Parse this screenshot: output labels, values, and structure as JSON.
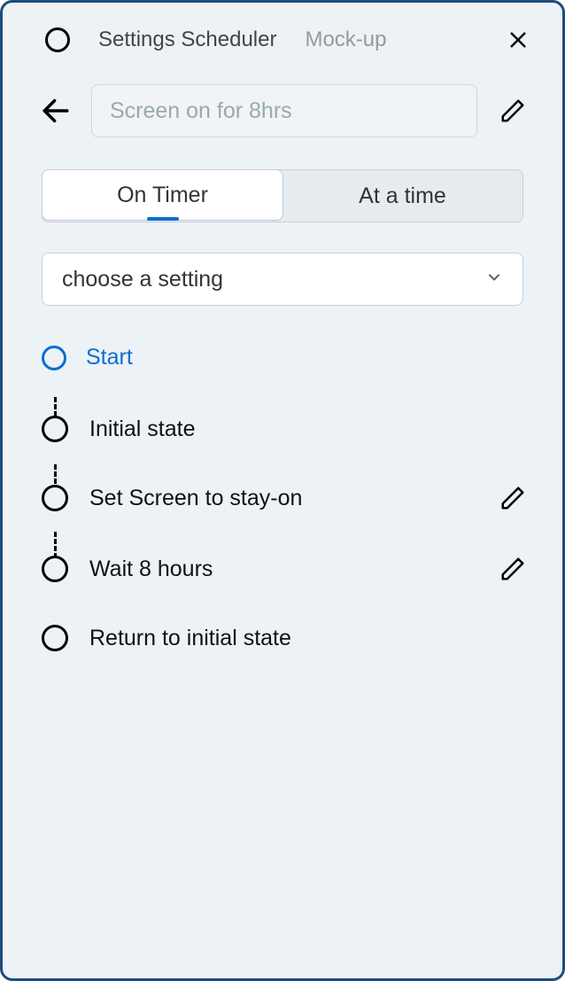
{
  "header": {
    "title": "Settings Scheduler",
    "subtitle": "Mock-up"
  },
  "search": {
    "placeholder": "Screen on for 8hrs",
    "value": ""
  },
  "tabs": [
    {
      "label": "On Timer",
      "active": true
    },
    {
      "label": "At a time",
      "active": false
    }
  ],
  "select": {
    "placeholder": "choose a setting"
  },
  "start": {
    "label": "Start"
  },
  "steps": [
    {
      "label": "Initial state",
      "editable": false
    },
    {
      "label": "Set Screen to stay-on",
      "editable": true
    },
    {
      "label": "Wait 8 hours",
      "editable": true
    },
    {
      "label": "Return to initial state",
      "editable": false
    }
  ]
}
